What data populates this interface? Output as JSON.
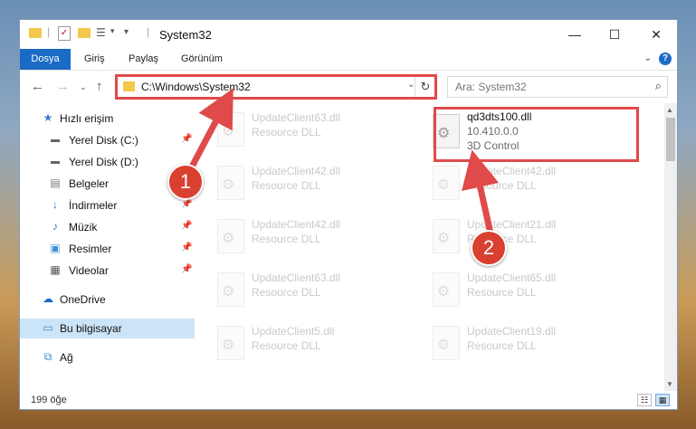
{
  "window": {
    "title": "System32",
    "minimize": "—",
    "maximize": "☐",
    "close": "✕"
  },
  "ribbon": {
    "tabs": [
      "Dosya",
      "Giriş",
      "Paylaş",
      "Görünüm"
    ],
    "help": "?"
  },
  "address": {
    "path": "C:\\Windows\\System32",
    "search_placeholder": "Ara: System32"
  },
  "sidebar": {
    "items": [
      {
        "label": "Hızlı erişim",
        "icon": "star-icon",
        "pinned": false
      },
      {
        "label": "Yerel Disk (C:)",
        "icon": "drive-icon",
        "pinned": true
      },
      {
        "label": "Yerel Disk (D:)",
        "icon": "drive-icon",
        "pinned": false
      },
      {
        "label": "Belgeler",
        "icon": "documents-icon",
        "pinned": true
      },
      {
        "label": "İndirmeler",
        "icon": "download-icon",
        "pinned": true
      },
      {
        "label": "Müzik",
        "icon": "music-icon",
        "pinned": true
      },
      {
        "label": "Resimler",
        "icon": "pictures-icon",
        "pinned": true
      },
      {
        "label": "Videolar",
        "icon": "videos-icon",
        "pinned": true
      },
      {
        "label": "OneDrive",
        "icon": "cloud-icon",
        "pinned": false
      },
      {
        "label": "Bu bilgisayar",
        "icon": "computer-icon",
        "pinned": false,
        "selected": true
      },
      {
        "label": "Ağ",
        "icon": "network-icon",
        "pinned": false
      }
    ]
  },
  "files": {
    "left": [
      {
        "name": "UpdateClient63.dll",
        "type": "Resource DLL"
      },
      {
        "name": "UpdateClient42.dll",
        "type": "Resource DLL"
      },
      {
        "name": "UpdateClient42.dll",
        "type": "Resource DLL"
      },
      {
        "name": "UpdateClient63.dll",
        "type": "Resource DLL"
      },
      {
        "name": "UpdateClient5.dll",
        "type": "Resource DLL"
      }
    ],
    "featured": {
      "name": "qd3dts100.dll",
      "version": "10.410.0.0",
      "type": "3D Control"
    },
    "right": [
      {
        "name": "UpdateClient42.dll",
        "type": "Resource DLL"
      },
      {
        "name": "UpdateClient21.dll",
        "type": "Resource DLL"
      },
      {
        "name": "UpdateClient65.dll",
        "type": "Resource DLL"
      },
      {
        "name": "UpdateClient19.dll",
        "type": "Resource DLL"
      }
    ]
  },
  "status": {
    "count": "199 öğe"
  },
  "annotations": {
    "step1": "1",
    "step2": "2",
    "color": "#e04a4a"
  }
}
